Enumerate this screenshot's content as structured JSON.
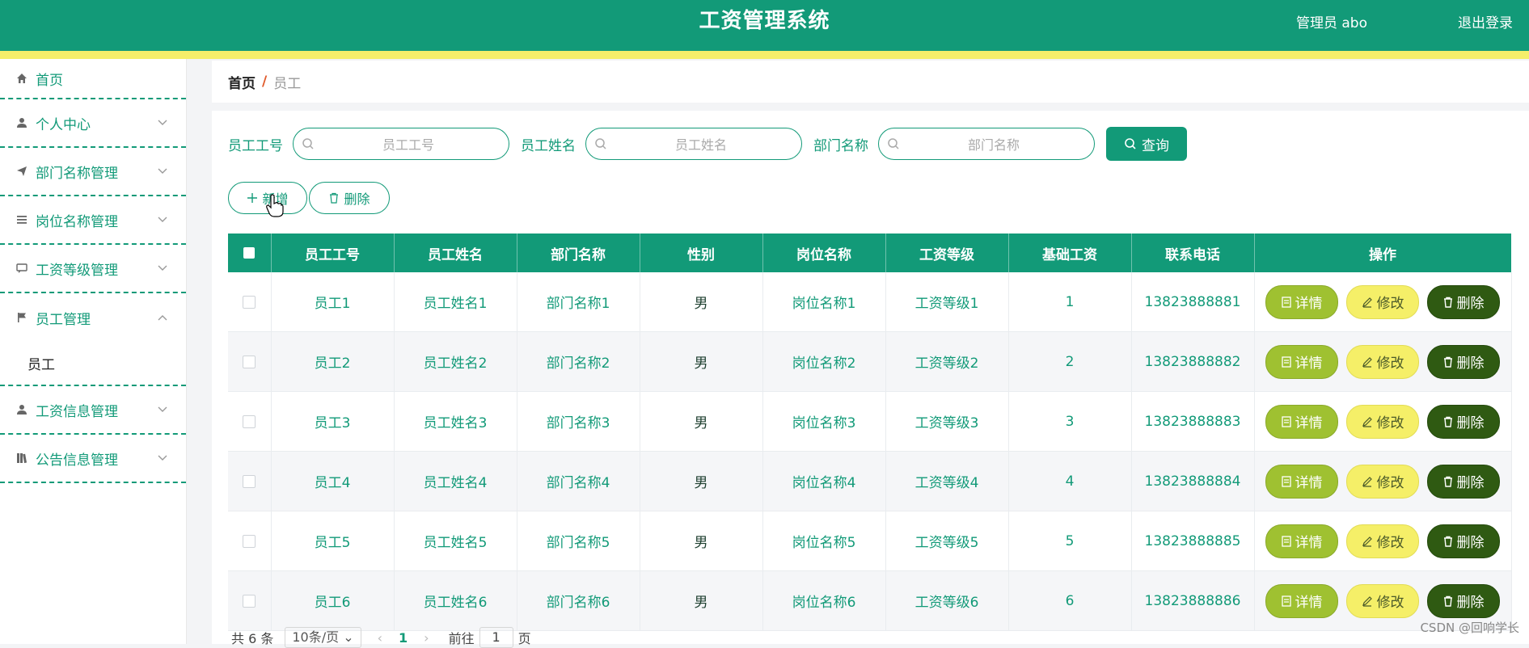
{
  "header": {
    "title": "工资管理系统",
    "user": "管理员 abo",
    "logout": "退出登录",
    "accent": "#129a78",
    "stripe": "#f5ee6a"
  },
  "sidebar": {
    "items": [
      {
        "label": "首页",
        "icon": "home-icon"
      },
      {
        "label": "个人中心",
        "icon": "user-icon"
      },
      {
        "label": "部门名称管理",
        "icon": "send-icon"
      },
      {
        "label": "岗位名称管理",
        "icon": "list-icon"
      },
      {
        "label": "工资等级管理",
        "icon": "message-icon"
      },
      {
        "label": "员工管理",
        "icon": "flag-icon",
        "expanded": true
      },
      {
        "label": "工资信息管理",
        "icon": "user-icon"
      },
      {
        "label": "公告信息管理",
        "icon": "book-icon"
      }
    ],
    "sub_item": "员工"
  },
  "breadcrumb": {
    "home": "首页",
    "sep": "/",
    "current": "员工"
  },
  "search": {
    "label_id": "员工工号",
    "ph_id": "员工工号",
    "label_name": "员工姓名",
    "ph_name": "员工姓名",
    "label_dept": "部门名称",
    "ph_dept": "部门名称",
    "query": "查询"
  },
  "actions": {
    "add": "新增",
    "delete": "删除"
  },
  "table": {
    "headers": [
      "员工工号",
      "员工姓名",
      "部门名称",
      "性别",
      "岗位名称",
      "工资等级",
      "基础工资",
      "联系电话",
      "操作"
    ],
    "rows": [
      [
        "员工1",
        "员工姓名1",
        "部门名称1",
        "男",
        "岗位名称1",
        "工资等级1",
        "1",
        "13823888881"
      ],
      [
        "员工2",
        "员工姓名2",
        "部门名称2",
        "男",
        "岗位名称2",
        "工资等级2",
        "2",
        "13823888882"
      ],
      [
        "员工3",
        "员工姓名3",
        "部门名称3",
        "男",
        "岗位名称3",
        "工资等级3",
        "3",
        "13823888883"
      ],
      [
        "员工4",
        "员工姓名4",
        "部门名称4",
        "男",
        "岗位名称4",
        "工资等级4",
        "4",
        "13823888884"
      ],
      [
        "员工5",
        "员工姓名5",
        "部门名称5",
        "男",
        "岗位名称5",
        "工资等级5",
        "5",
        "13823888885"
      ],
      [
        "员工6",
        "员工姓名6",
        "部门名称6",
        "男",
        "岗位名称6",
        "工资等级6",
        "6",
        "13823888886"
      ]
    ],
    "op_detail": "详情",
    "op_edit": "修改",
    "op_delete": "删除"
  },
  "pager": {
    "total": "共 6 条",
    "page_size": "10条/页",
    "prev": "‹",
    "page": "1",
    "next": "›",
    "goto": "前往",
    "goto_value": "1",
    "unit": "页"
  },
  "watermark": "CSDN @回响学长"
}
